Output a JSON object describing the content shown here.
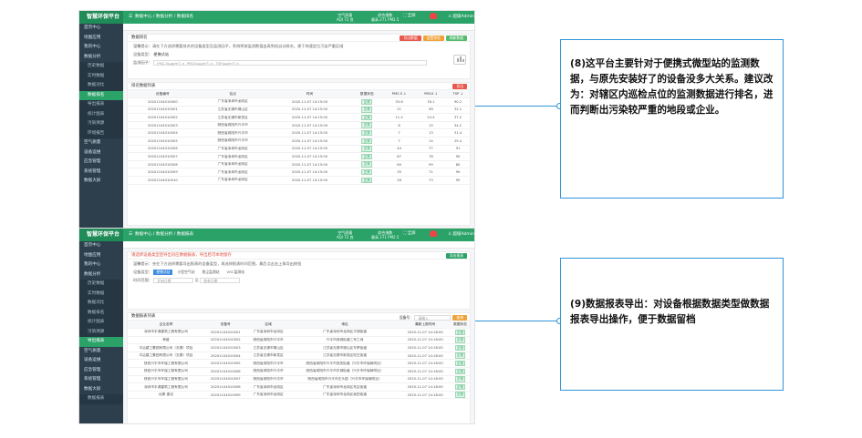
{
  "app": {
    "brand": "智慧环保平台"
  },
  "sidebar": {
    "items1": [
      {
        "label": "首页中心",
        "kind": "main"
      },
      {
        "label": "地图应用",
        "kind": "main"
      },
      {
        "label": "我的中心",
        "kind": "main"
      },
      {
        "label": "数据分析",
        "kind": "main"
      },
      {
        "label": "历史数据",
        "kind": "sub"
      },
      {
        "label": "实时数据",
        "kind": "sub"
      },
      {
        "label": "数据对比",
        "kind": "sub"
      },
      {
        "label": "数据排名",
        "kind": "active"
      },
      {
        "label": "导出报表",
        "kind": "sub"
      },
      {
        "label": "统计图表",
        "kind": "sub"
      },
      {
        "label": "污染溯源",
        "kind": "sub"
      },
      {
        "label": "环境报告",
        "kind": "sub"
      },
      {
        "label": "空气质量",
        "kind": "main"
      },
      {
        "label": "设备运维",
        "kind": "main"
      },
      {
        "label": "应急管理",
        "kind": "main"
      },
      {
        "label": "系统管理",
        "kind": "main"
      },
      {
        "label": "数据大屏",
        "kind": "main"
      }
    ],
    "items2": [
      {
        "label": "首页中心",
        "kind": "main"
      },
      {
        "label": "地图应用",
        "kind": "main"
      },
      {
        "label": "我的中心",
        "kind": "main"
      },
      {
        "label": "数据分析",
        "kind": "main"
      },
      {
        "label": "历史数据",
        "kind": "sub"
      },
      {
        "label": "实时数据",
        "kind": "sub"
      },
      {
        "label": "数据对比",
        "kind": "sub"
      },
      {
        "label": "数据排名",
        "kind": "sub"
      },
      {
        "label": "统计图表",
        "kind": "sub"
      },
      {
        "label": "污染溯源",
        "kind": "sub"
      },
      {
        "label": "导出报表",
        "kind": "active"
      },
      {
        "label": "空气质量",
        "kind": "main"
      },
      {
        "label": "设备运维",
        "kind": "main"
      },
      {
        "label": "应急管理",
        "kind": "main"
      },
      {
        "label": "系统管理",
        "kind": "main"
      },
      {
        "label": "数据大屏",
        "kind": "main"
      },
      {
        "label": "数据报表",
        "kind": "sub"
      }
    ]
  },
  "screen1": {
    "breadcrumb": "数据中心 / 数据分析 / 数据排名",
    "kpi1": {
      "label": "空气质量",
      "value": "AQI 72 良"
    },
    "kpi2": {
      "label": "综合指数",
      "value": "最高 271 PM2.5"
    },
    "fullscreen": "全屏",
    "user": "超级Admin",
    "tabs": [
      "数据中心",
      "地图应用",
      "历史数据",
      "数据对比",
      "实时数据",
      "数据排名"
    ],
    "panel_title": "数据排名",
    "hint": "温馨提示：请在下方选择需要排名的设备类型及监测因子，系统将按监测数值由高到低自动排名，便于快速定位污染严重区域",
    "type_label": "设备类型：",
    "type_value": "便携式站",
    "factor_label": "监测因子：",
    "factor_chips": [
      "PM2.5(μg/m³)",
      "PM10(μg/m³)",
      "TSP(μg/m³)"
    ],
    "buttons": [
      "导出数据",
      "设置排名",
      "刷新数据"
    ],
    "table_title": "排名数据列表",
    "export_btn": "导出",
    "cols": [
      "设备编号",
      "站点",
      "时间",
      "数据状态",
      "PM2.5 ↓",
      "PM10 ↓",
      "TSP ↓"
    ],
    "rows": [
      [
        "20201104010000",
        "广东省深圳市龙岗区",
        "2020-11-07 14:15:00",
        "正常",
        "53.6",
        "76.1",
        "90.2"
      ],
      [
        "20201104010001",
        "江苏省无锡市锡山区",
        "2020-11-07 14:15:00",
        "正常",
        "21",
        "58",
        "32.1"
      ],
      [
        "20201104010002",
        "江苏省无锡市新吴区",
        "2020-11-07 14:15:00",
        "正常",
        "11.4",
        "24.4",
        "37.2"
      ],
      [
        "20201104010003",
        "陕西省咸阳市兴平市",
        "2020-11-07 14:15:00",
        "正常",
        "8",
        "15",
        "34.2"
      ],
      [
        "20201104010004",
        "陕西省咸阳市兴平市",
        "2020-11-07 14:15:00",
        "正常",
        "7",
        "13",
        "31.4"
      ],
      [
        "20201104010005",
        "陕西省咸阳市兴平市",
        "2020-11-07 14:15:00",
        "正常",
        "7",
        "14",
        "25.4"
      ],
      [
        "20201104010006",
        "广东省深圳市龙岗区",
        "2020-11-07 14:15:00",
        "正常",
        "44",
        "77",
        "91"
      ],
      [
        "20201104010007",
        "广东省深圳市龙岗区",
        "2020-11-07 14:15:00",
        "正常",
        "87",
        "78",
        "90"
      ],
      [
        "20201104010008",
        "广东省深圳市龙岗区",
        "2020-11-07 14:15:00",
        "正常",
        "60",
        "99",
        "80"
      ],
      [
        "20201104010009",
        "广东省深圳市龙岗区",
        "2020-11-07 14:15:00",
        "正常",
        "35",
        "71",
        "90"
      ],
      [
        "20201104010010",
        "广东省深圳市龙岗区",
        "2020-11-07 14:15:00",
        "正常",
        "28",
        "73",
        "90"
      ]
    ]
  },
  "screen2": {
    "breadcrumb": "数据中心 / 数据分析 / 数据报表",
    "kpi1": {
      "label": "空气质量",
      "value": "AQI 72 良"
    },
    "kpi2": {
      "label": "综合指数",
      "value": "最高 271 PM2.5"
    },
    "fullscreen": "全屏",
    "user": "超级Admin",
    "tabs": [
      "数据中心",
      "地图应用",
      "历史数据",
      "数据对比",
      "实时数据",
      "数据排名",
      "统计图表",
      "污染溯源",
      "环境报告",
      "空气质量",
      "设备运维",
      "应急管理",
      "系统管理",
      "数据报表"
    ],
    "alert": "请选择设备类型后导出对应数据报表，导出后可本地留存",
    "export_top": "导出报表",
    "hint": "温馨提示：先在下方选择需要导出报表的设备类型，再选择报表时间范围，最后点击右上角导出按钮",
    "type_label": "设备类型：",
    "type_chips": [
      "便携式站",
      "小型空气站",
      "扬尘监测站",
      "VOC监测站"
    ],
    "date_label": "时间范围：",
    "date_start": "开始日期",
    "date_sep": "至",
    "date_end": "结束日期",
    "table_title": "数据报表列表",
    "search_label": "设备号：",
    "search_placeholder": "请输入",
    "search_btn": "查询",
    "cols": [
      "企业名称",
      "设备号",
      "区域",
      "地址",
      "最新上报时间",
      "数据状态"
    ],
    "rows": [
      [
        "深圳市丰源建筑工程有限公司",
        "20201104010001",
        "广东省深圳市龙岗区",
        "广东省深圳市龙岗区平湖街道",
        "2020-11-07 14:18:00",
        "正常"
      ],
      [
        "荣盛",
        "20201104010002",
        "陕西省咸阳市兴平市",
        "兴平市西城街道三号工地",
        "2020-11-07 14:18:00",
        "正常"
      ],
      [
        "中冶建工集团有限公司（无锡）项目",
        "20201104010003",
        "江苏省无锡市锡山区",
        "江苏省无锡市锡山区东亭街道",
        "2020-11-07 14:18:00",
        "正常"
      ],
      [
        "中冶建工集团有限公司（无锡）项目",
        "20201104010004",
        "江苏省无锡市新吴区",
        "江苏省无锡市新吴区旺庄街道",
        "2020-11-07 14:18:00",
        "正常"
      ],
      [
        "陕西兴平市环保工程有限公司",
        "20201104010005",
        "陕西省咸阳市兴平市",
        "陕西省咸阳市兴平市西吴街道（兴平市环保局附近）",
        "2020-11-07 14:18:00",
        "正常"
      ],
      [
        "陕西兴平市环保工程有限公司",
        "20201104010006",
        "陕西省咸阳市兴平市",
        "陕西省咸阳市兴平市东城街道（兴平市环保局附近）",
        "2020-11-07 14:18:00",
        "正常"
      ],
      [
        "陕西兴平市环保工程有限公司",
        "20201104010007",
        "陕西省咸阳市兴平市",
        "陕西省咸阳市兴平市庄头镇（兴平市环保局附近）",
        "2020-11-07 14:18:00",
        "正常"
      ],
      [
        "深圳市丰源建筑工程有限公司",
        "20201104010008",
        "广东省深圳市龙岗区",
        "广东省深圳市龙岗区布吉街道",
        "2020-11-07 14:18:00",
        "正常"
      ],
      [
        "远景 建设",
        "20201104010009",
        "广东省深圳市龙岗区",
        "广东省深圳市龙岗区坂田街道",
        "2020-11-07 14:18:00",
        "正常"
      ]
    ]
  },
  "callouts": {
    "c1": "(8)这平台主要针对于便携式微型站的监测数据，与原先安装好了的设备没多大关系。建议改为：对辖区内巡检点位的监测数据进行排名，进而判断出污染较严重的地段或企业。",
    "c2": "(9)数据报表导出：对设备根据数据类型做数据报表导出操作，便于数据留档"
  },
  "colors": {
    "brand": "#2aa268",
    "sidebar": "#2d3f4c",
    "callout_border": "#2f95d8"
  }
}
